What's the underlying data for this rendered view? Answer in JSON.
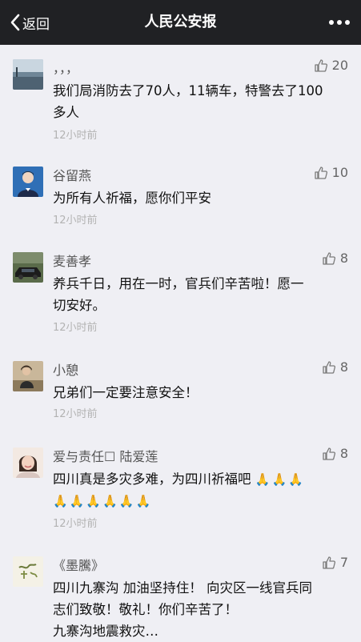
{
  "nav": {
    "back_label": "返回",
    "title": "人民公安报"
  },
  "comments": [
    {
      "name": "，，，",
      "likes": "20",
      "lines": [
        "我们局消防去了70人，11辆车，特警去了100",
        "多人"
      ],
      "time": "12小时前"
    },
    {
      "name": "谷留燕",
      "likes": "10",
      "lines": [
        "为所有人祈福，愿你们平安"
      ],
      "time": "12小时前"
    },
    {
      "name": "麦善孝",
      "likes": "8",
      "lines": [
        "养兵千日，用在一时，官兵们辛苦啦！愿一",
        "切安好。"
      ],
      "time": "12小时前"
    },
    {
      "name": "小憩",
      "likes": "8",
      "lines": [
        "兄弟们一定要注意安全！"
      ],
      "time": "12小时前"
    },
    {
      "name": "爱与责任☐ 陆爱莲",
      "likes": "8",
      "line1": "四川真是多灾多难，为四川祈福吧",
      "emoji": "🙏",
      "time": "12小时前"
    },
    {
      "name": "《墨騰》",
      "likes": "7",
      "lines": [
        "四川九寨沟 加油坚持住！ 向灾区一线官兵同",
        "志们致敬！敬礼！你们辛苦了！",
        "九寨沟地震救灾…"
      ],
      "time": ""
    }
  ],
  "icons": {
    "back": "chevron-left-icon",
    "more": "more-dots-icon",
    "like": "thumbs-up-icon"
  },
  "colors": {
    "navbar": "#202124",
    "background": "#efeff4",
    "time": "#b3b3b3"
  }
}
